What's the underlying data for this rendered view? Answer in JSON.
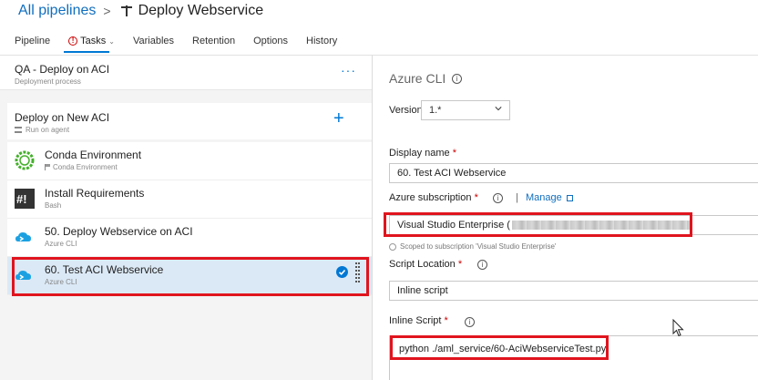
{
  "breadcrumb": {
    "root": "All pipelines",
    "separator": ">",
    "current": "Deploy Webservice"
  },
  "tabs": [
    {
      "label": "Pipeline",
      "active": false
    },
    {
      "label": "Tasks",
      "active": true,
      "has_error": true
    },
    {
      "label": "Variables",
      "active": false
    },
    {
      "label": "Retention",
      "active": false
    },
    {
      "label": "Options",
      "active": false
    },
    {
      "label": "History",
      "active": false
    }
  ],
  "stage": {
    "title": "QA - Deploy on ACI",
    "subtitle": "Deployment process",
    "more": "···"
  },
  "job": {
    "title": "Deploy on New ACI",
    "subtitle": "Run on agent",
    "add": "+"
  },
  "tasks": [
    {
      "name": "Conda Environment",
      "sub": "Conda Environment",
      "icon": "conda-icon"
    },
    {
      "name": "Install Requirements",
      "sub": "Bash",
      "icon": "bash-icon"
    },
    {
      "name": "50. Deploy Webservice on ACI",
      "sub": "Azure CLI",
      "icon": "azure-cli-icon"
    },
    {
      "name": "60. Test ACI Webservice",
      "sub": "Azure CLI",
      "icon": "azure-cli-icon",
      "selected": true
    }
  ],
  "detail": {
    "title": "Azure CLI",
    "version_label": "Version",
    "version_value": "1.*",
    "display_name_label": "Display name",
    "display_name_value": "60. Test ACI Webservice",
    "subscription_label": "Azure subscription",
    "manage_separator": "|",
    "manage_label": "Manage",
    "subscription_value": "Visual Studio Enterprise (",
    "scoped_note": "Scoped to subscription 'Visual Studio Enterprise'",
    "script_location_label": "Script Location",
    "script_location_value": "Inline script",
    "inline_script_label": "Inline Script",
    "inline_script_value": "python ./aml_service/60-AciWebserviceTest.py",
    "required_mark": "*"
  },
  "colors": {
    "accent": "#0078d4",
    "link": "#106ebe",
    "highlight": "#e0141e",
    "selected_row": "#dbe9f6",
    "left_panel_bg": "#f4f4f4"
  }
}
